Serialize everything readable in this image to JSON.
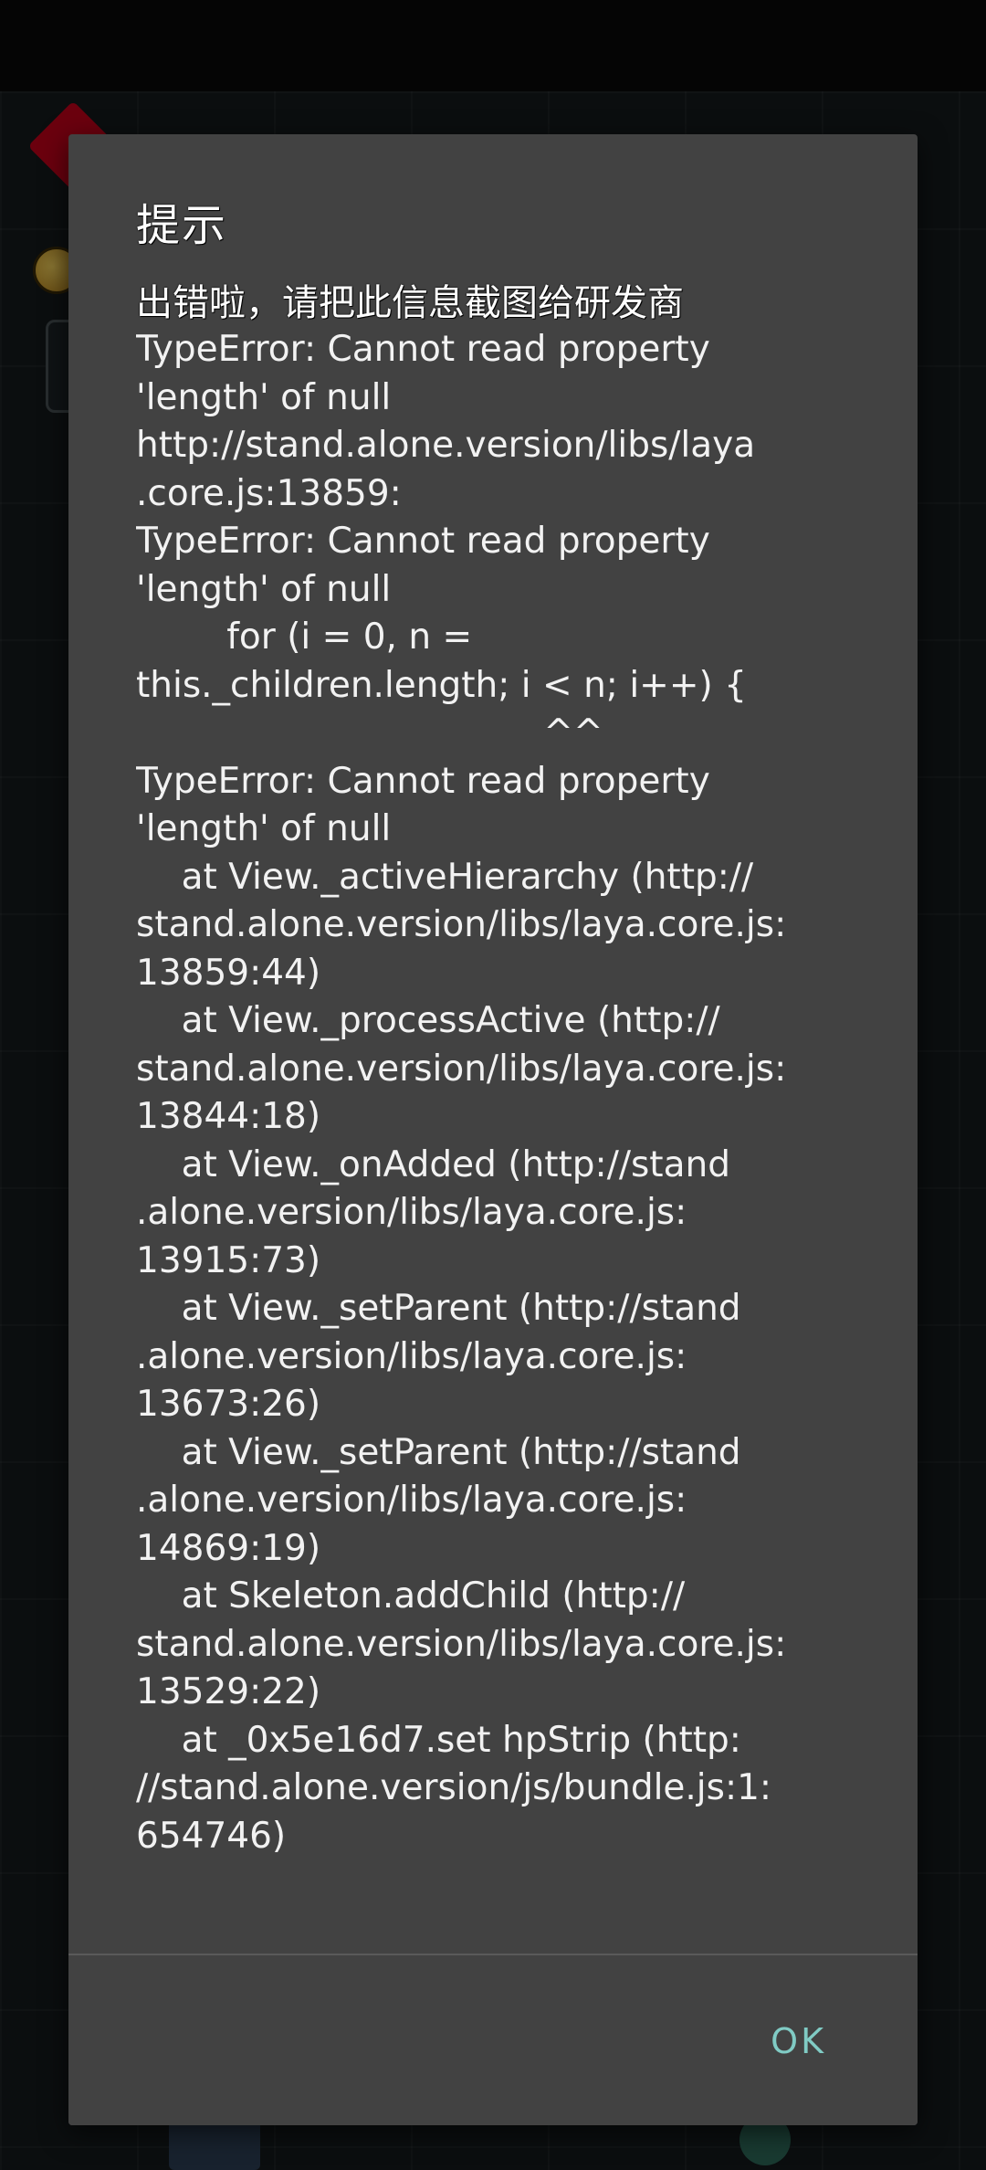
{
  "dialog": {
    "title": "提示",
    "heading": "出错啦，请把此信息截图给研发商",
    "message": "TypeError: Cannot read property\n'length' of null\nhttp://stand.alone.version/libs/laya\n.core.js:13859:\nTypeError: Cannot read property\n'length' of null\n        for (i = 0, n =\nthis._children.length; i < n; i++) {\n                                    ^^\nTypeError: Cannot read property\n'length' of null\n    at View._activeHierarchy (http://\nstand.alone.version/libs/laya.core.js:\n13859:44)\n    at View._processActive (http://\nstand.alone.version/libs/laya.core.js:\n13844:18)\n    at View._onAdded (http://stand\n.alone.version/libs/laya.core.js:\n13915:73)\n    at View._setParent (http://stand\n.alone.version/libs/laya.core.js:\n13673:26)\n    at View._setParent (http://stand\n.alone.version/libs/laya.core.js:\n14869:19)\n    at Skeleton.addChild (http://\nstand.alone.version/libs/laya.core.js:\n13529:22)\n    at _0x5e16d7.set hpStrip (http:\n//stand.alone.version/js/bundle.js:1:\n654746)",
    "ok_label": "OK",
    "accent_color": "#80cbc4",
    "background_color": "#424242"
  }
}
